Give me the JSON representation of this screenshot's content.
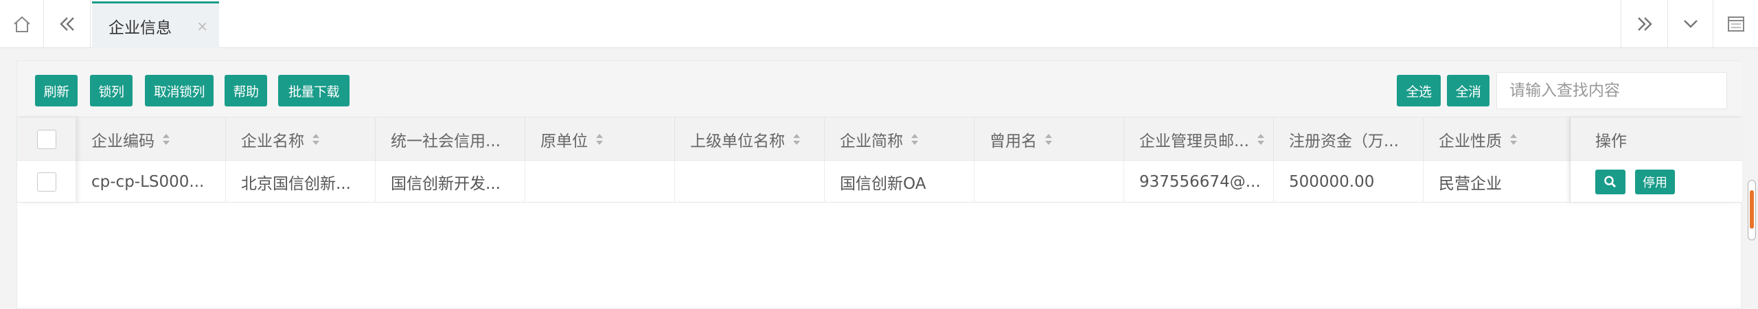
{
  "tabbar": {
    "icons": {
      "home": "home-icon",
      "back": "double-left-icon",
      "forward": "double-right-icon",
      "dropdown": "chevron-down-icon",
      "window": "window-icon"
    },
    "active_tab": {
      "label": "企业信息",
      "close": "×"
    }
  },
  "toolbar": {
    "buttons": [
      "刷新",
      "锁列",
      "取消锁列",
      "帮助",
      "批量下载"
    ],
    "select_all": "全选",
    "deselect_all": "全消",
    "search_placeholder": "请输入查找内容"
  },
  "table": {
    "columns": [
      "企业编码",
      "企业名称",
      "统一社会信用...",
      "原单位",
      "上级单位名称",
      "企业简称",
      "曾用名",
      "企业管理员邮...",
      "注册资金（万...",
      "企业性质",
      "操作"
    ],
    "rows": [
      {
        "code": "cp-cp-LS000...",
        "name": "北京国信创新...",
        "credit_code": "国信创新开发...",
        "original_unit": "",
        "parent_unit": "",
        "short_name": "国信创新OA",
        "former_name": "",
        "admin_email": "937556674@...",
        "capital": "500000.00",
        "nature": "民营企业",
        "disable_label": "停用"
      }
    ]
  },
  "colors": {
    "accent": "#1a9c8a",
    "scroll_thumb": "#e8742c"
  }
}
